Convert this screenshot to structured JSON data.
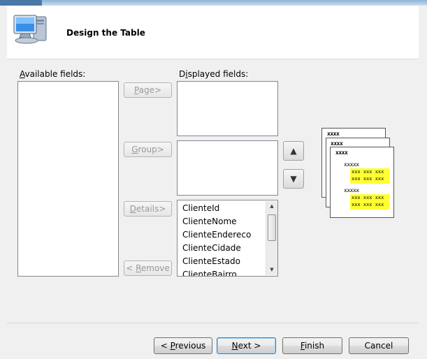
{
  "header": {
    "title": "Design the Table"
  },
  "available_fields": {
    "label_prefix": "",
    "label_accel": "A",
    "label_rest": "vailable fields:",
    "items": []
  },
  "displayed_fields": {
    "label_prefix": "D",
    "label_accel": "i",
    "label_rest": "splayed fields:",
    "items": [
      "ClienteId",
      "ClienteNome",
      "ClienteEndereco",
      "ClienteCidade",
      "ClienteEstado",
      "ClienteBairro"
    ]
  },
  "buttons": {
    "page": {
      "accel": "P",
      "rest": "age>"
    },
    "group": {
      "accel": "G",
      "rest": "roup>"
    },
    "details": {
      "accel": "D",
      "rest": "etails>"
    },
    "remove": {
      "pre": "< ",
      "accel": "R",
      "rest": "emove"
    },
    "move_up": "▲",
    "move_down": "▼"
  },
  "preview": {
    "page_header": "xxxx",
    "group_header": "xxxxx",
    "detail_row": "xxx xxx xxx"
  },
  "footer": {
    "previous": {
      "pre": "< ",
      "accel": "P",
      "rest": "revious"
    },
    "next": {
      "accel": "N",
      "rest": "ext >"
    },
    "finish": {
      "accel": "F",
      "rest": "inish"
    },
    "cancel": "Cancel"
  }
}
